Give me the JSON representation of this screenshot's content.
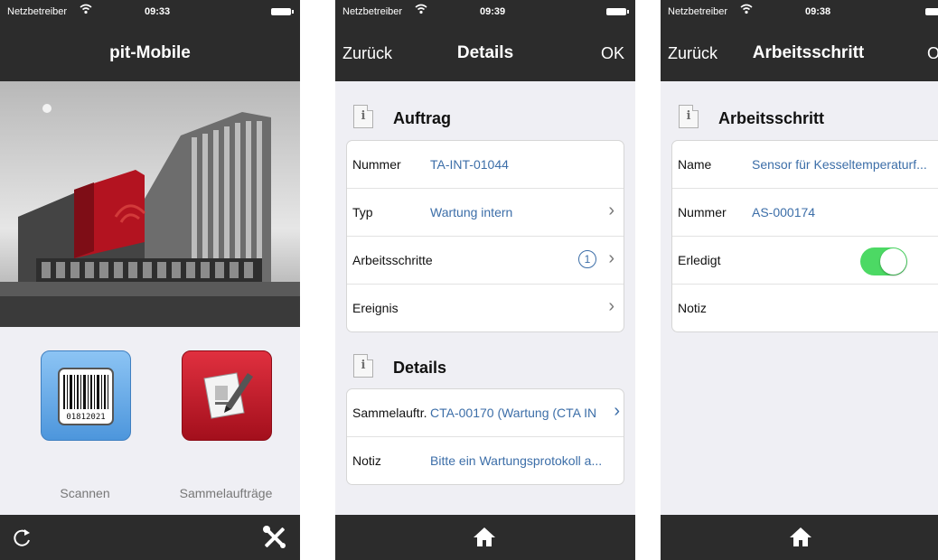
{
  "colors": {
    "bar_bg": "#2c2c2c",
    "page_bg": "#efeff4",
    "link_blue": "#3c6ea8",
    "toggle_on": "#4cd964",
    "tile_blue": "#5ba3e8",
    "tile_red": "#c8102e"
  },
  "icons": {
    "wifi": "wifi-icon",
    "battery": "battery-icon",
    "info": "info-icon",
    "chevron": "chevron-right-icon",
    "refresh": "refresh-icon",
    "tools": "tools-icon",
    "home": "home-icon",
    "barcode": "barcode-icon",
    "edit": "edit-document-icon"
  },
  "screen1": {
    "status": {
      "carrier": "Netzbetreiber",
      "time": "09:33"
    },
    "title": "pit-Mobile",
    "tiles": [
      {
        "label": "Scannen",
        "barcode_number": "01812021"
      },
      {
        "label": "Sammelaufträge"
      }
    ]
  },
  "screen2": {
    "status": {
      "carrier": "Netzbetreiber",
      "time": "09:39"
    },
    "back": "Zurück",
    "title": "Details",
    "ok": "OK",
    "section1": "Auftrag",
    "rows1": [
      {
        "key": "Nummer",
        "value": "TA-INT-01044"
      },
      {
        "key": "Typ",
        "value": "Wartung intern"
      },
      {
        "key": "Arbeitsschritte",
        "badge": "1"
      },
      {
        "key": "Ereignis"
      }
    ],
    "section2": "Details",
    "rows2": [
      {
        "key": "Sammelauftr.",
        "value": "CTA-00170 (Wartung (CTA IN"
      },
      {
        "key": "Notiz",
        "value": "Bitte ein Wartungsprotokoll a..."
      }
    ]
  },
  "screen3": {
    "status": {
      "carrier": "Netzbetreiber",
      "time": "09:38"
    },
    "back": "Zurück",
    "title": "Arbeitsschritt",
    "ok": "O",
    "section1": "Arbeitsschritt",
    "rows": [
      {
        "key": "Name",
        "value": "Sensor für Kesseltemperaturf..."
      },
      {
        "key": "Nummer",
        "value": "AS-000174"
      },
      {
        "key": "Erledigt",
        "toggle_on": true
      },
      {
        "key": "Notiz"
      }
    ]
  }
}
